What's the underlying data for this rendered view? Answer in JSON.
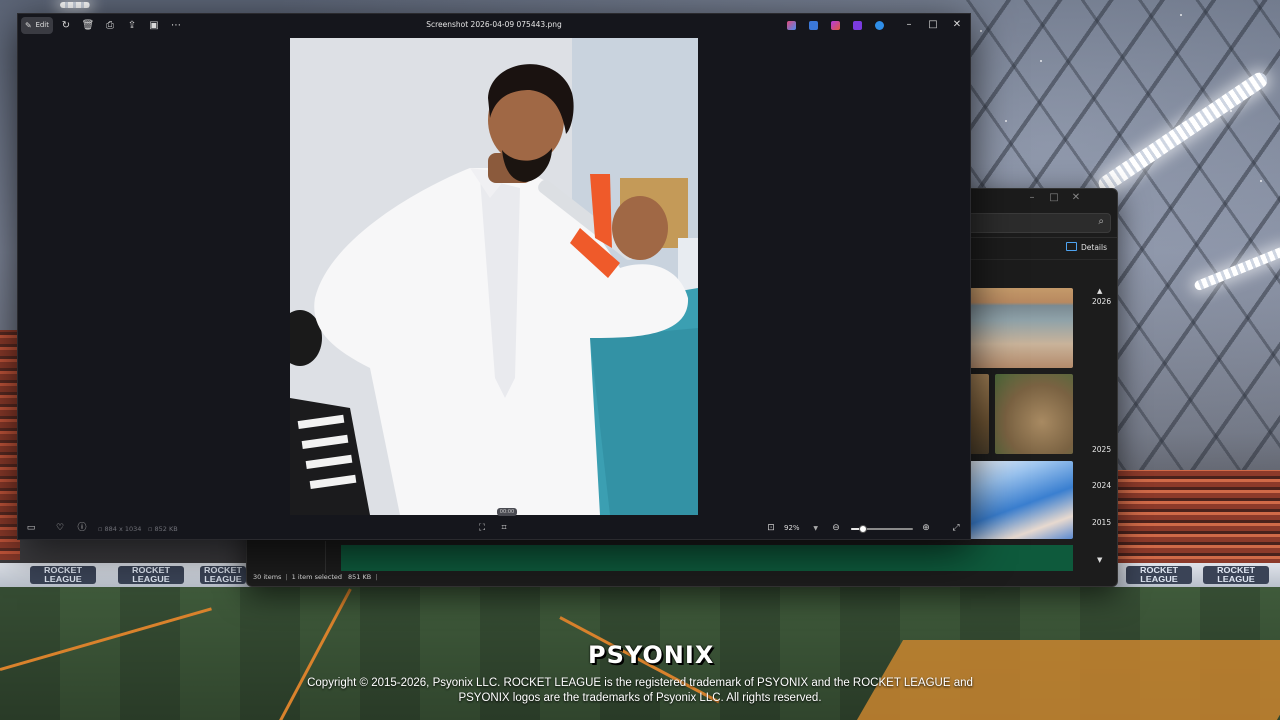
{
  "viewer": {
    "title": "Screenshot 2026-04-09 075443.png",
    "edit_label": "Edit",
    "image_dimensions": "884 x 1034",
    "file_size": "852 KB",
    "zoom_level": "92%",
    "zoom_fraction": 0.2,
    "playback_time": "00:00"
  },
  "explorer": {
    "details_label": "Details",
    "years": [
      "2026",
      "2025",
      "2024",
      "2015"
    ],
    "status": {
      "items": "30 items",
      "selected": "1 item selected",
      "size": "851 KB"
    }
  },
  "scene": {
    "brand_logo": "PSYONIX",
    "ad_text": [
      "ROCKET",
      "LEAGUE"
    ],
    "copyright_line1": "Copyright © 2015-2026, Psyonix LLC. ROCKET LEAGUE is the registered trademark of PSYONIX and the ROCKET LEAGUE and",
    "copyright_line2": "PSYONIX logos are the trademarks of Psyonix LLC. All rights reserved."
  },
  "icons": {
    "toolbar": [
      "pen-icon",
      "rotate-icon",
      "delete-icon",
      "print-icon",
      "share-icon",
      "slideshow-icon",
      "more-icon"
    ],
    "window": [
      "minimize-icon",
      "maximize-icon",
      "close-icon"
    ],
    "bottom": [
      "filmstrip-icon",
      "favorite-icon",
      "info-icon",
      "fit-icon",
      "crop-icon",
      "actual-size-icon",
      "zoom-out-icon",
      "zoom-in-icon",
      "fullscreen-icon"
    ]
  },
  "colors": {
    "accent": "#4ea3f0",
    "green_bar": "#0e5a3c",
    "viewer_bg": "#15161c"
  }
}
